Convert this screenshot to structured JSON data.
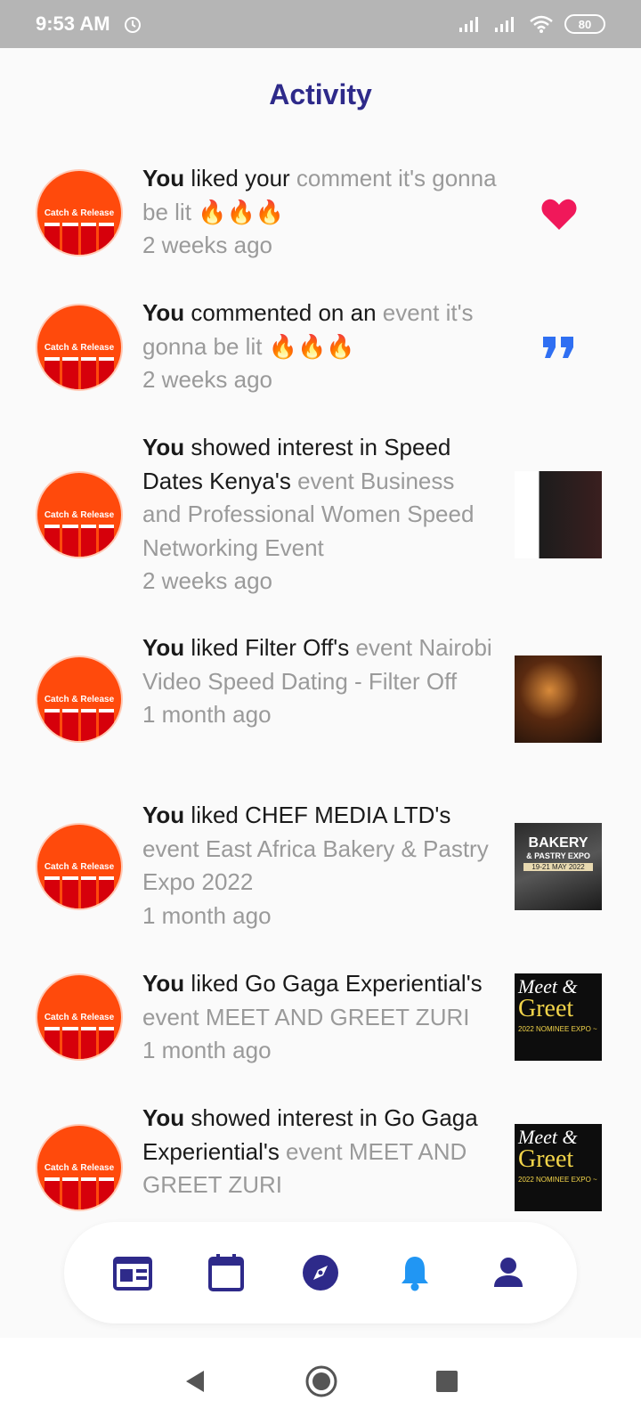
{
  "status_bar": {
    "time": "9:53 AM",
    "battery": "80"
  },
  "header": {
    "title": "Activity"
  },
  "avatar_text": "Catch & Release",
  "activities": [
    {
      "you": "You",
      "verb": " liked  your ",
      "muted": " comment it's gonna be lit 🔥🔥🔥",
      "time": "2 weeks ago",
      "trailing": "heart-icon"
    },
    {
      "you": "You",
      "verb": " commented on an ",
      "muted": "event it's gonna be lit 🔥🔥🔥",
      "time": "2 weeks ago",
      "trailing": "quote-icon"
    },
    {
      "you": "You",
      "verb": " showed interest in Speed Dates Kenya's ",
      "muted": " event Business and Professional Women Speed Networking Event",
      "time": "2 weeks ago",
      "trailing": "event-thumbnail"
    },
    {
      "you": "You",
      "verb": " liked Filter Off's ",
      "muted": " event Nairobi Video Speed Dating - Filter Off",
      "time": "1 month ago",
      "trailing": "event-thumbnail"
    },
    {
      "you": "You",
      "verb": " liked CHEF MEDIA LTD's ",
      "muted": "event East Africa Bakery & Pastry Expo 2022",
      "time": "1 month ago",
      "trailing": "event-thumbnail"
    },
    {
      "you": "You",
      "verb": " liked Go Gaga Experiential's ",
      "muted": "event MEET AND GREET ZURI",
      "time": "1 month ago",
      "trailing": "event-thumbnail"
    },
    {
      "you": "You",
      "verb": " showed interest in Go Gaga Experiential's ",
      "muted": " event MEET AND GREET ZURI",
      "time": "",
      "trailing": "event-thumbnail"
    }
  ],
  "thumbs": {
    "bakery_title": "BAKERY",
    "bakery_sub": "& PASTRY EXPO",
    "bakery_date": "19-21 MAY 2022",
    "meet_line1": "Meet &",
    "meet_line2": "Greet",
    "meet_sub": "2022 NOMINEE EXPO ~"
  },
  "bottom_nav": [
    "feed-icon",
    "calendar-icon",
    "compass-icon",
    "bell-icon",
    "profile-icon"
  ],
  "colors": {
    "accent": "#2e2a8a",
    "active": "#2196f3",
    "heart": "#f0185a",
    "quote": "#2f6ff2",
    "avatar_bg": "#ff4a0c"
  }
}
